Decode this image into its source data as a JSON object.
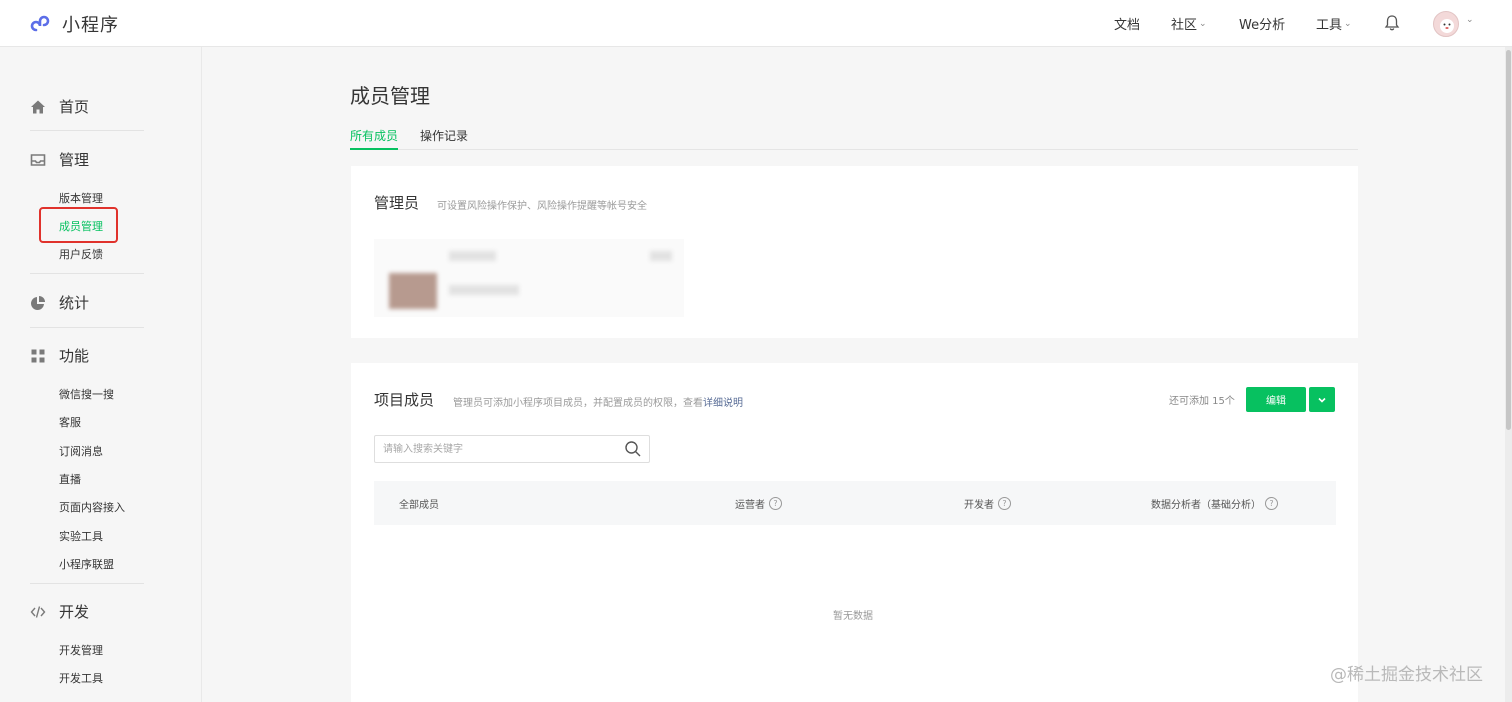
{
  "header": {
    "app_name": "小程序",
    "nav": [
      {
        "label": "文档",
        "has_dropdown": false
      },
      {
        "label": "社区",
        "has_dropdown": true
      },
      {
        "label": "We分析",
        "has_dropdown": false
      },
      {
        "label": "工具",
        "has_dropdown": true
      }
    ],
    "bell_icon": "bell-icon",
    "chevron": "⌄"
  },
  "sidebar": {
    "groups": [
      {
        "label": "首页",
        "icon": "home-icon"
      },
      {
        "label": "管理",
        "icon": "inbox-icon",
        "items": [
          "版本管理",
          "成员管理",
          "用户反馈"
        ]
      },
      {
        "label": "统计",
        "icon": "pie-chart-icon"
      },
      {
        "label": "功能",
        "icon": "grid-icon",
        "items": [
          "微信搜一搜",
          "客服",
          "订阅消息",
          "直播",
          "页面内容接入",
          "实验工具",
          "小程序联盟"
        ]
      },
      {
        "label": "开发",
        "icon": "code-icon",
        "items": [
          "开发管理",
          "开发工具"
        ]
      }
    ],
    "active_item": "成员管理"
  },
  "main": {
    "title": "成员管理",
    "tabs": [
      {
        "label": "所有成员",
        "active": true
      },
      {
        "label": "操作记录",
        "active": false
      }
    ],
    "admin_card": {
      "title": "管理员",
      "desc": "可设置风险操作保护、风险操作提醒等帐号安全"
    },
    "members_card": {
      "title": "项目成员",
      "desc": "管理员可添加小程序项目成员，并配置成员的权限，查看",
      "desc_link": "详细说明",
      "add_count": "还可添加 15个",
      "edit_label": "编辑",
      "search_placeholder": "请输入搜索关键字",
      "columns": [
        "全部成员",
        "运营者",
        "开发者",
        "数据分析者（基础分析）"
      ],
      "help_mark": "?",
      "empty_text": "暂无数据"
    }
  },
  "watermark": "@稀土掘金技术社区",
  "colors": {
    "accent": "#07c160",
    "link": "#576b95",
    "highlight": "#e0322c"
  }
}
